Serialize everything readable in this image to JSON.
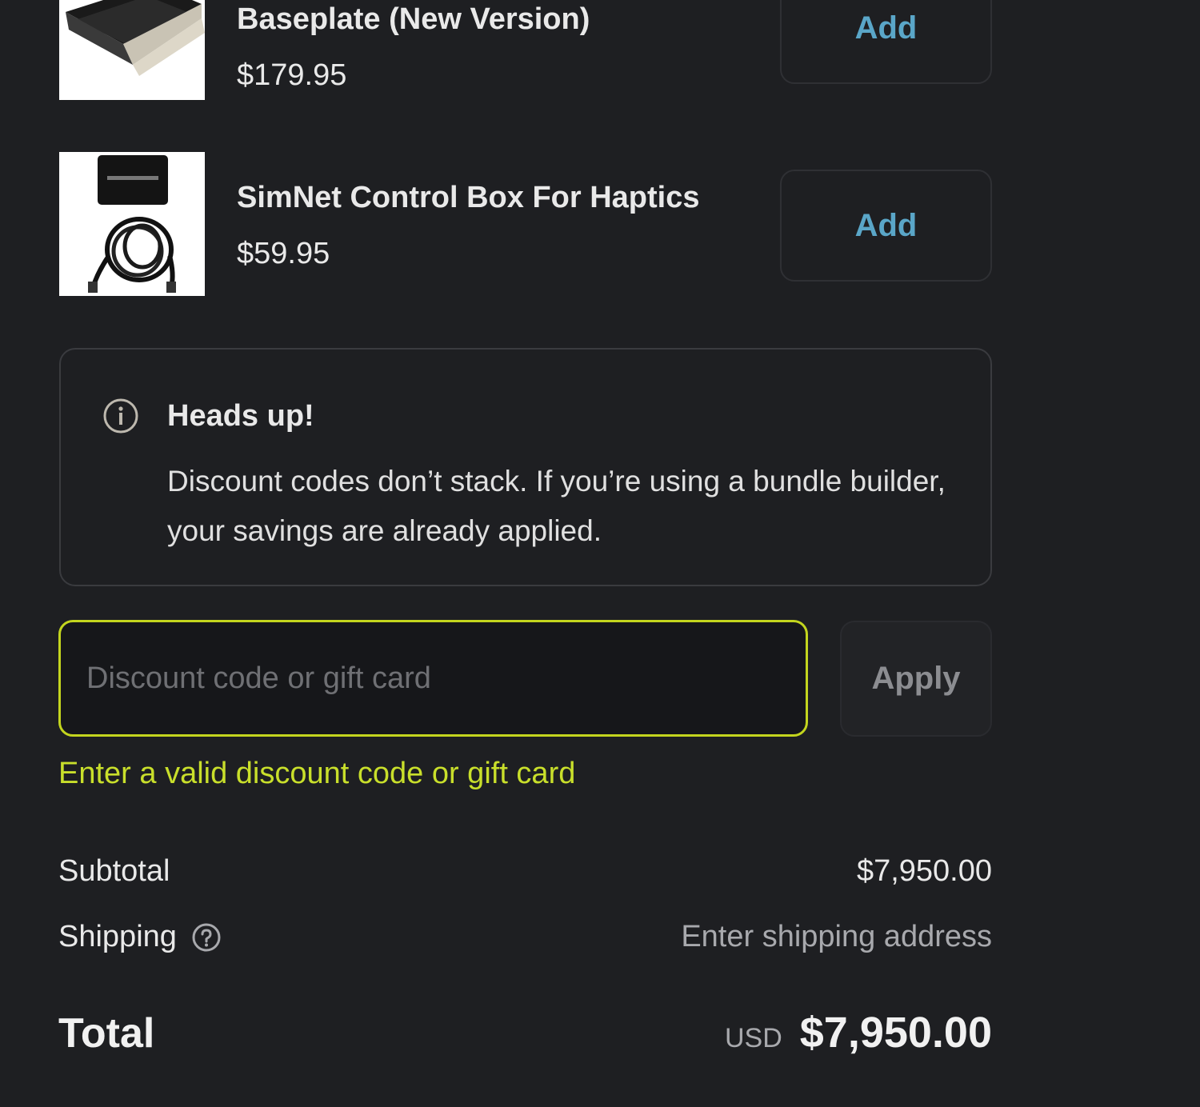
{
  "products": [
    {
      "name": "Baseplate (New Version)",
      "price": "$179.95",
      "add_label": "Add"
    },
    {
      "name": "SimNet Control Box For Haptics",
      "price": "$59.95",
      "add_label": "Add"
    }
  ],
  "notice": {
    "icon": "info-icon",
    "title": "Heads up!",
    "body": "Discount codes don’t stack. If you’re using a bundle builder, your savings are already applied."
  },
  "discount": {
    "placeholder": "Discount code or gift card",
    "value": "",
    "apply_label": "Apply",
    "error": "Enter a valid discount code or gift card"
  },
  "summary": {
    "subtotal_label": "Subtotal",
    "subtotal_value": "$7,950.00",
    "shipping_label": "Shipping",
    "shipping_value": "Enter shipping address",
    "total_label": "Total",
    "currency": "USD",
    "total_value": "$7,950.00"
  },
  "colors": {
    "background": "#1e1f22",
    "accent_link": "#5aa6c8",
    "error": "#c9df2b"
  }
}
